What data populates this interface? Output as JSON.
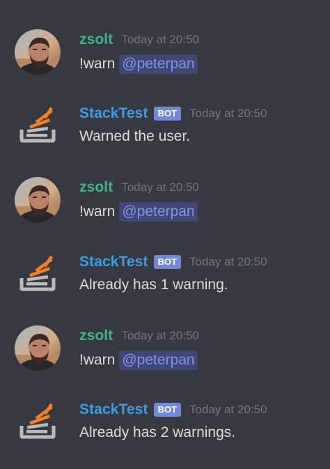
{
  "messages": [
    {
      "author": "zsolt",
      "timestamp": "Today at 20:50",
      "text": "!warn",
      "mention": "@peterpan",
      "is_bot": false
    },
    {
      "author": "StackTest",
      "badge": "BOT",
      "timestamp": "Today at 20:50",
      "text": "Warned the user.",
      "is_bot": true
    },
    {
      "author": "zsolt",
      "timestamp": "Today at 20:50",
      "text": "!warn",
      "mention": "@peterpan",
      "is_bot": false
    },
    {
      "author": "StackTest",
      "badge": "BOT",
      "timestamp": "Today at 20:50",
      "text": "Already has 1 warning.",
      "is_bot": true
    },
    {
      "author": "zsolt",
      "timestamp": "Today at 20:50",
      "text": "!warn",
      "mention": "@peterpan",
      "is_bot": false
    },
    {
      "author": "StackTest",
      "badge": "BOT",
      "timestamp": "Today at 20:50",
      "text": "Already has 2 warnings.",
      "is_bot": true
    }
  ],
  "colors": {
    "background": "#36393f",
    "user_name": "#3bb68a",
    "bot_name": "#3d9de6",
    "bot_badge": "#7289da",
    "mention_bg": "#414675",
    "mention_text": "#7e96e8",
    "timestamp": "#72767d",
    "message_text": "#dcddde",
    "stack_orange": "#f48024",
    "stack_gray": "#bcbbbb"
  },
  "icons": {
    "user_avatar": "user-photo-avatar",
    "bot_avatar": "stack-overflow-logo-icon"
  }
}
